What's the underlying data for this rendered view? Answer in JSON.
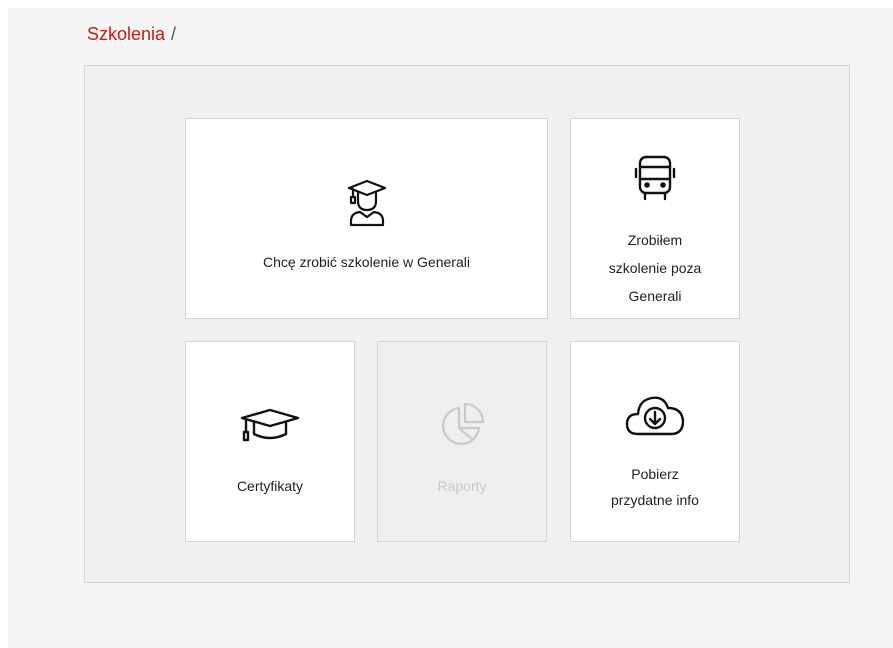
{
  "breadcrumb": {
    "current": "Szkolenia",
    "separator": "/"
  },
  "tiles": [
    {
      "id": "chce-zrobic-szkolenie",
      "label": "Chcę zrobić szkolenie w Generali",
      "icon": "student-graduate-icon",
      "enabled": true
    },
    {
      "id": "zrobilem-szkolenie",
      "label_lines": [
        "Zrobiłem",
        "szkolenie poza",
        "Generali"
      ],
      "icon": "bus-icon",
      "enabled": true
    },
    {
      "id": "certyfikaty",
      "label": "Certyfikaty",
      "icon": "graduation-cap-icon",
      "enabled": true
    },
    {
      "id": "raporty",
      "label": "Raporty",
      "icon": "pie-chart-icon",
      "enabled": false
    },
    {
      "id": "pobierz-info",
      "label_lines": [
        "Pobierz",
        "przydatne info"
      ],
      "icon": "cloud-download-icon",
      "enabled": true
    }
  ],
  "colors": {
    "accent": "#c21b17",
    "tile_bg": "#ffffff",
    "disabled_text": "#c9c9c9",
    "panel_bg": "#f0f0f0"
  }
}
